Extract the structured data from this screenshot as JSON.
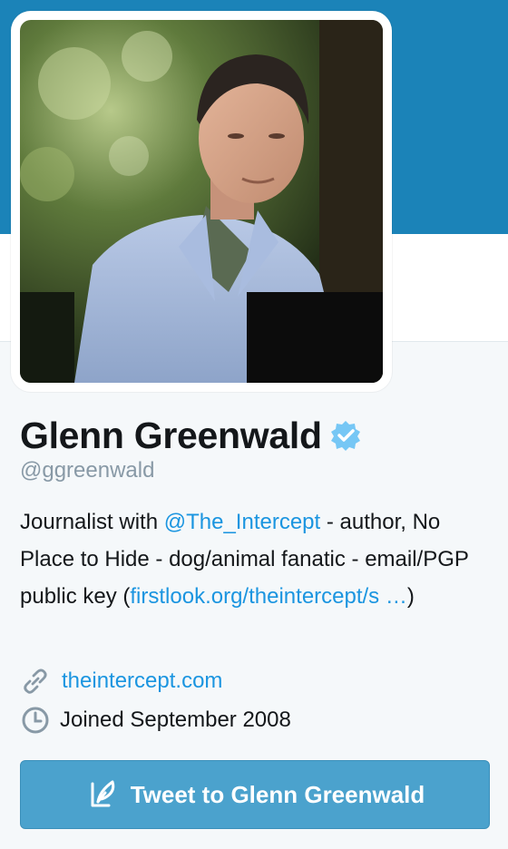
{
  "colors": {
    "banner": "#1b83b8",
    "link": "#1b95e0",
    "button": "#4ba2cd",
    "verified": "#76c7f5"
  },
  "profile": {
    "name": "Glenn Greenwald",
    "handle": "@ggreenwald",
    "verified_icon": "verified-badge-icon",
    "bio": {
      "part1": "Journalist with ",
      "mention": "@The_Intercept",
      "part2": " - author, No Place to Hide - dog/animal fanatic - email/PGP public key (",
      "link": "firstlook.org/theintercept/s  …",
      "part3": ")"
    },
    "url": {
      "icon": "link-icon",
      "text": "theintercept.com"
    },
    "joined": {
      "icon": "clock-icon",
      "text": "Joined September 2008"
    }
  },
  "actions": {
    "tweet_to_icon": "compose-tweet-icon",
    "tweet_to_label": "Tweet to Glenn Greenwald"
  }
}
